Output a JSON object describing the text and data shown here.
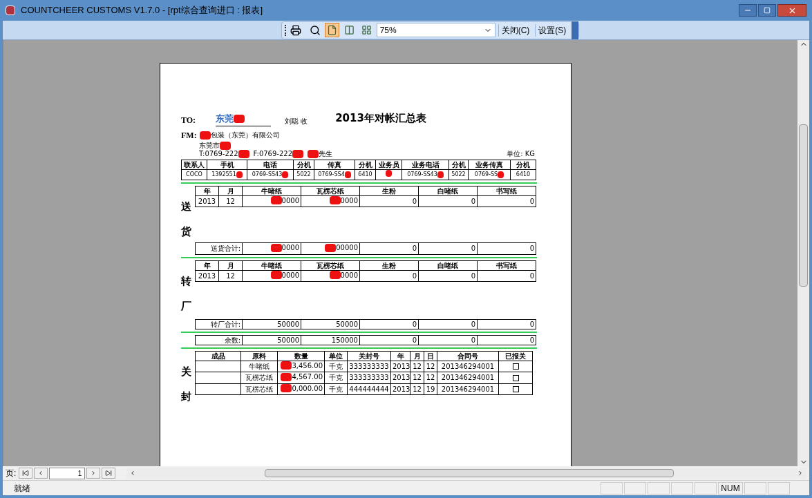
{
  "window": {
    "title": "COUNTCHEER CUSTOMS V1.7.0 - [rpt综合查询进口 : 报表]"
  },
  "toolbar": {
    "views": [
      {
        "selected": true
      },
      {
        "selected": false
      },
      {
        "selected": false
      }
    ],
    "zoom": "75%",
    "buttons": [
      "关闭(C)",
      "设置(S)"
    ]
  },
  "report": {
    "to_label": "TO:",
    "to": {
      "text": "东莞",
      "redacted_after": true
    },
    "to_note": "刘聪 收",
    "title": "2013年对帐汇总表",
    "fm_label": "FM:",
    "fm": {
      "text": "包装（东莞）有限公司",
      "redacted_before": true
    },
    "address": {
      "text": "东莞市",
      "redacted_after": true
    },
    "phone": {
      "text": "T:0769-222",
      "redacted_after": true
    },
    "fax": {
      "text": "F:0769-222",
      "redacted_after": true
    },
    "contact": {
      "text": "先生",
      "redacted_before": true
    },
    "unit": "单位: KG",
    "contacts": {
      "columns": [
        "联系人",
        "手机",
        "电话",
        "分机",
        "传真",
        "分机",
        "业务员",
        "业务电话",
        "分机",
        "业务传真",
        "分机"
      ],
      "row": [
        {
          "text": "COCO"
        },
        {
          "text": "1392551",
          "redacted_after": true
        },
        {
          "text": "0769-SS43",
          "redacted_after": true
        },
        {
          "text": "5022"
        },
        {
          "text": "0769-SS4",
          "redacted_after": true
        },
        {
          "text": "6410"
        },
        {
          "redacted_after": true
        },
        {
          "text": "0769-SS43",
          "redacted_after": true
        },
        {
          "text": "5022"
        },
        {
          "text": "0769-SS",
          "redacted_after": true
        },
        {
          "text": "6410"
        }
      ]
    },
    "sections": [
      {
        "label": "送货",
        "columns": [
          "年",
          "月",
          "牛啫纸",
          "瓦楞芯纸",
          "生粉",
          "白啫纸",
          "书写纸"
        ],
        "row": [
          {
            "text": "2013"
          },
          {
            "text": "12"
          },
          {
            "text": "0000",
            "redacted_before": true
          },
          {
            "text": "0000",
            "redacted_before": true
          },
          {
            "text": "0"
          },
          {
            "text": "0"
          },
          {
            "text": "0"
          }
        ],
        "total_label": "送货合计:",
        "totals": [
          {
            "text": "0000",
            "redacted_before": true
          },
          {
            "text": "00000",
            "redacted_before": true
          },
          {
            "text": "0"
          },
          {
            "text": "0"
          },
          {
            "text": "0"
          }
        ]
      },
      {
        "label": "转厂",
        "columns": [
          "年",
          "月",
          "牛啫纸",
          "瓦楞芯纸",
          "生粉",
          "白啫纸",
          "书写纸"
        ],
        "row": [
          {
            "text": "2013"
          },
          {
            "text": "12"
          },
          {
            "text": "0000",
            "redacted_before": true
          },
          {
            "text": "0000",
            "redacted_before": true
          },
          {
            "text": "0"
          },
          {
            "text": "0"
          },
          {
            "text": "0"
          }
        ],
        "total_label": "转厂合计:",
        "totals": [
          {
            "text": "50000"
          },
          {
            "text": "50000"
          },
          {
            "text": "0"
          },
          {
            "text": "0"
          },
          {
            "text": "0"
          }
        ]
      }
    ],
    "balance": {
      "label": "余数:",
      "values": [
        "50000",
        "150000",
        "0",
        "0",
        "0"
      ]
    },
    "seal": {
      "label": "关封",
      "columns": [
        "成品",
        "原料",
        "数量",
        "单位",
        "关封号",
        "年",
        "月",
        "日",
        "合同号",
        "已报关"
      ],
      "rows": [
        {
          "material": "牛啫纸",
          "quantity": {
            "text": "3,456.00",
            "redacted_before": true
          },
          "unit": "千克",
          "seal_no": "333333333",
          "year": "2013",
          "month": "12",
          "day": "12",
          "contract": "201346294001",
          "checked": false
        },
        {
          "material": "瓦楞芯纸",
          "quantity": {
            "text": "4,567.00",
            "redacted_before": true
          },
          "unit": "千克",
          "seal_no": "333333333",
          "year": "2013",
          "month": "12",
          "day": "12",
          "contract": "201346294001",
          "checked": false
        },
        {
          "material": "瓦楞芯纸",
          "quantity": {
            "text": "0,000.00",
            "redacted_before": true
          },
          "unit": "千克",
          "seal_no": "444444444",
          "year": "2013",
          "month": "12",
          "day": "19",
          "contract": "201346294001",
          "checked": false
        }
      ]
    }
  },
  "pager": {
    "label": "页:",
    "page": "1"
  },
  "status_bar": {
    "text": "就绪",
    "indicator": "NUM"
  }
}
